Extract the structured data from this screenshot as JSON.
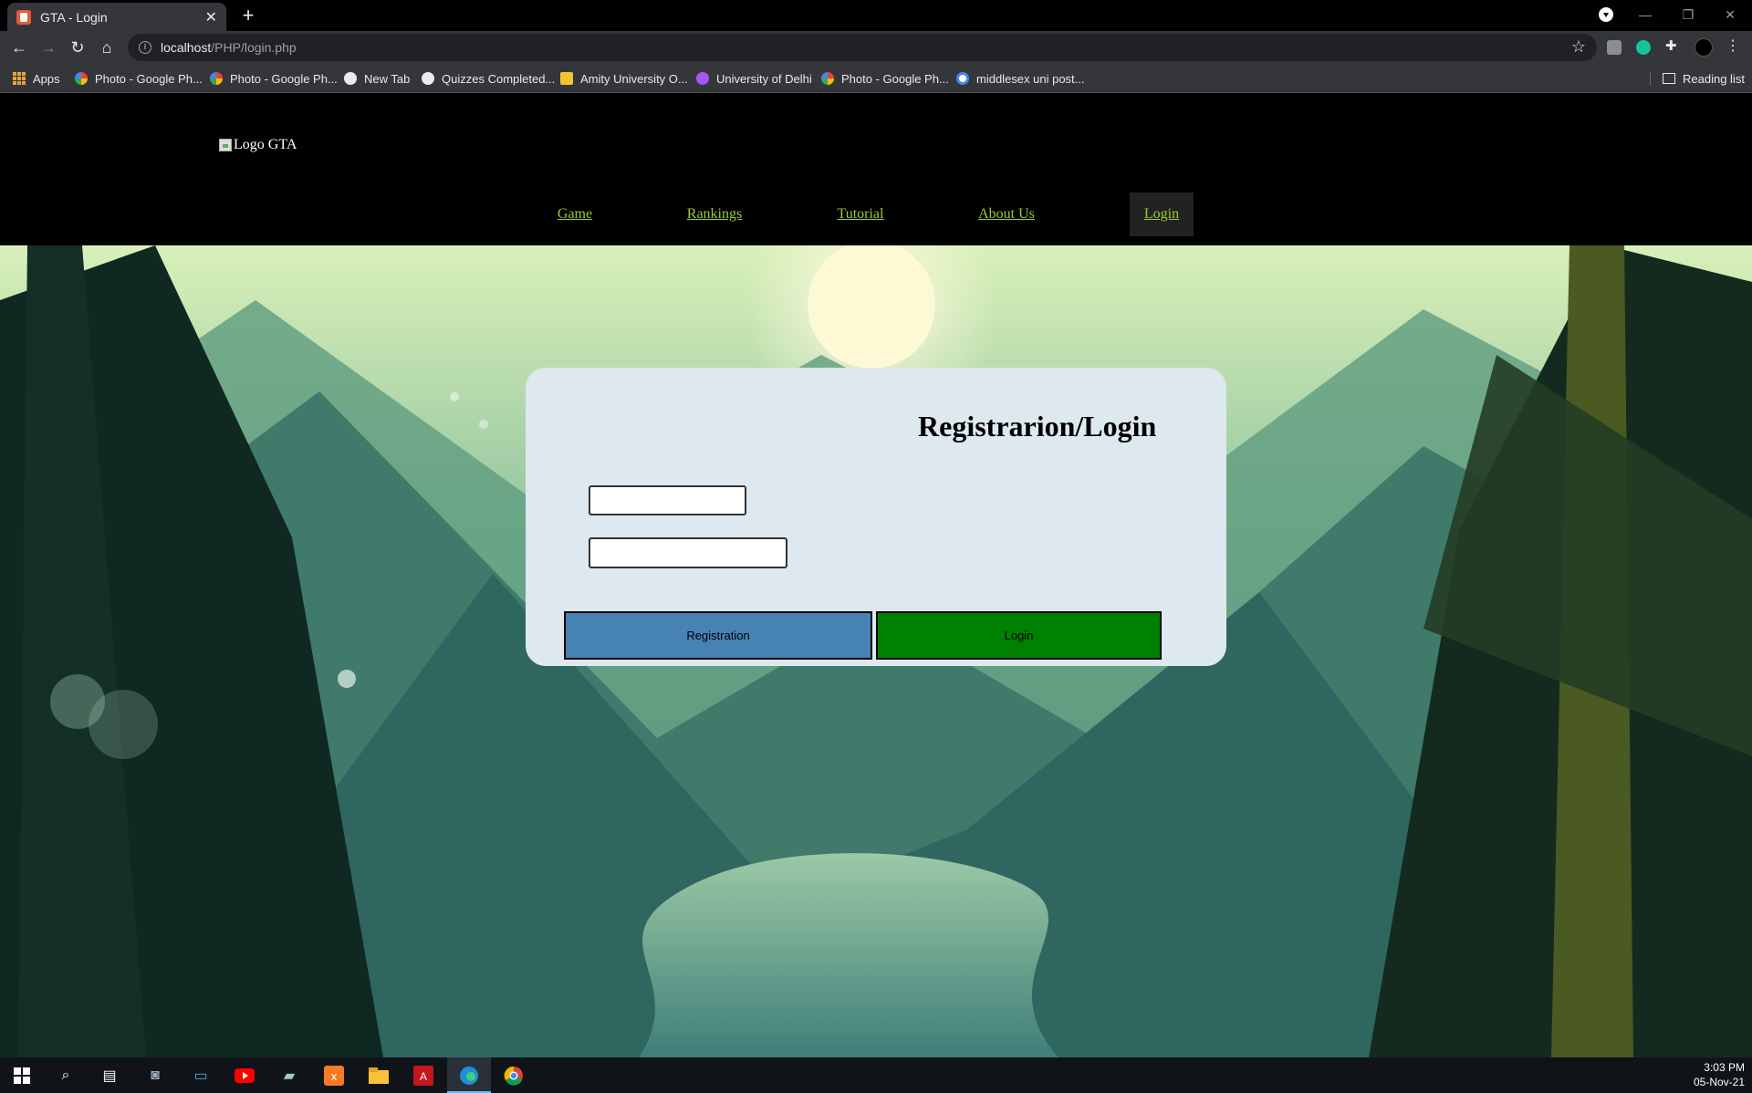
{
  "browser": {
    "tab_title": "GTA - Login",
    "tab_close": "✕",
    "new_tab": "+",
    "url_host": "localhost",
    "url_path": "/PHP/login.php",
    "bookmarks": [
      {
        "label": "Apps",
        "color": "#e8a33a"
      },
      {
        "label": "Photo - Google Ph...",
        "color": "#f4b400"
      },
      {
        "label": "Photo - Google Ph...",
        "color": "#f4b400"
      },
      {
        "label": "New Tab",
        "color": "#e8eaed"
      },
      {
        "label": "Quizzes Completed...",
        "color": "#e8eaed"
      },
      {
        "label": "Amity University O...",
        "color": "#f4c430"
      },
      {
        "label": "University of Delhi",
        "color": "#a855f7"
      },
      {
        "label": "Photo - Google Ph...",
        "color": "#f4b400"
      },
      {
        "label": "middlesex uni post...",
        "color": "#4285f4"
      }
    ],
    "reading_list": "Reading list"
  },
  "site": {
    "logo_alt": "Logo GTA",
    "nav": {
      "game": "Game",
      "rankings": "Rankings",
      "tutorial": "Tutorial",
      "about": "About Us",
      "login": "Login"
    },
    "nav_color": "#9acd32"
  },
  "form": {
    "title": "Registrarion/Login",
    "username_value": "",
    "password_value": "",
    "registration_label": "Registration",
    "login_label": "Login",
    "registration_color": "#4682b4",
    "login_color": "#008000"
  },
  "taskbar": {
    "time": "3:03 PM",
    "date": "05-Nov-21"
  }
}
